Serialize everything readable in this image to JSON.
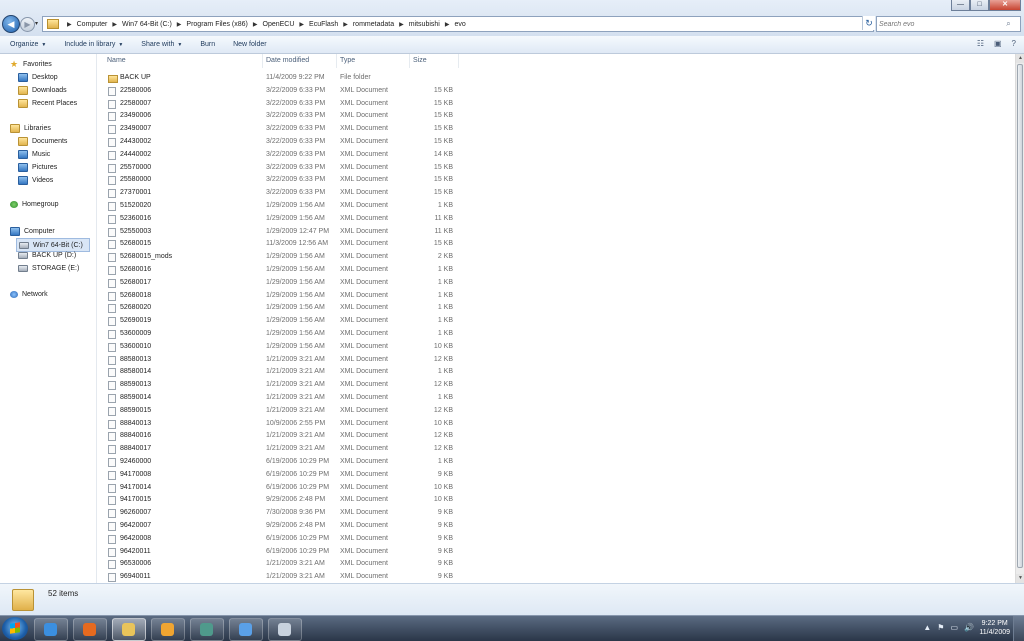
{
  "window": {
    "controls": {
      "minimize": "—",
      "maximize": "□",
      "close": "✕"
    }
  },
  "nav": {
    "back_icon": "back-arrow-icon",
    "forward_icon": "forward-arrow-icon",
    "back_glyph": "◀",
    "forward_glyph": "▶",
    "history_glyph": "▾"
  },
  "address": {
    "crumbs": [
      "Computer",
      "Win7 64-Bit (C:)",
      "Program Files (x86)",
      "OpenECU",
      "EcuFlash",
      "rommetadata",
      "mitsubishi",
      "evo"
    ],
    "separator": "▶",
    "dropdown_glyph": "▾",
    "refresh_glyph": "↻"
  },
  "search": {
    "placeholder": "Search evo",
    "icon_glyph": "⌕"
  },
  "toolbar": {
    "organize": "Organize",
    "include": "Include in library",
    "share": "Share with",
    "burn": "Burn",
    "new_folder": "New folder",
    "dropdown_glyph": "▼",
    "view_glyph": "☷",
    "pane_glyph": "▣",
    "help_glyph": "?"
  },
  "sidebar": {
    "favorites": {
      "label": "Favorites",
      "items": [
        "Desktop",
        "Downloads",
        "Recent Places"
      ]
    },
    "libraries": {
      "label": "Libraries",
      "items": [
        "Documents",
        "Music",
        "Pictures",
        "Videos"
      ]
    },
    "homegroup": "Homegroup",
    "computer": {
      "label": "Computer",
      "items": [
        "Win7 64-Bit (C:)",
        "BACK UP (D:)",
        "STORAGE (E:)"
      ]
    },
    "network": "Network"
  },
  "columns": {
    "name": "Name",
    "date": "Date modified",
    "type": "Type",
    "size": "Size"
  },
  "files": [
    {
      "name": "BACK UP",
      "date": "11/4/2009 9:22 PM",
      "type": "File folder",
      "size": "",
      "folder": true
    },
    {
      "name": "22580006",
      "date": "3/22/2009 6:33 PM",
      "type": "XML Document",
      "size": "15 KB"
    },
    {
      "name": "22580007",
      "date": "3/22/2009 6:33 PM",
      "type": "XML Document",
      "size": "15 KB"
    },
    {
      "name": "23490006",
      "date": "3/22/2009 6:33 PM",
      "type": "XML Document",
      "size": "15 KB"
    },
    {
      "name": "23490007",
      "date": "3/22/2009 6:33 PM",
      "type": "XML Document",
      "size": "15 KB"
    },
    {
      "name": "24430002",
      "date": "3/22/2009 6:33 PM",
      "type": "XML Document",
      "size": "15 KB"
    },
    {
      "name": "24440002",
      "date": "3/22/2009 6:33 PM",
      "type": "XML Document",
      "size": "14 KB"
    },
    {
      "name": "25570000",
      "date": "3/22/2009 6:33 PM",
      "type": "XML Document",
      "size": "15 KB"
    },
    {
      "name": "25580000",
      "date": "3/22/2009 6:33 PM",
      "type": "XML Document",
      "size": "15 KB"
    },
    {
      "name": "27370001",
      "date": "3/22/2009 6:33 PM",
      "type": "XML Document",
      "size": "15 KB"
    },
    {
      "name": "51520020",
      "date": "1/29/2009 1:56 AM",
      "type": "XML Document",
      "size": "1 KB"
    },
    {
      "name": "52360016",
      "date": "1/29/2009 1:56 AM",
      "type": "XML Document",
      "size": "11 KB"
    },
    {
      "name": "52550003",
      "date": "1/29/2009 12:47 PM",
      "type": "XML Document",
      "size": "11 KB"
    },
    {
      "name": "52680015",
      "date": "11/3/2009 12:56 AM",
      "type": "XML Document",
      "size": "15 KB"
    },
    {
      "name": "52680015_mods",
      "date": "1/29/2009 1:56 AM",
      "type": "XML Document",
      "size": "2 KB"
    },
    {
      "name": "52680016",
      "date": "1/29/2009 1:56 AM",
      "type": "XML Document",
      "size": "1 KB"
    },
    {
      "name": "52680017",
      "date": "1/29/2009 1:56 AM",
      "type": "XML Document",
      "size": "1 KB"
    },
    {
      "name": "52680018",
      "date": "1/29/2009 1:56 AM",
      "type": "XML Document",
      "size": "1 KB"
    },
    {
      "name": "52680020",
      "date": "1/29/2009 1:56 AM",
      "type": "XML Document",
      "size": "1 KB"
    },
    {
      "name": "52690019",
      "date": "1/29/2009 1:56 AM",
      "type": "XML Document",
      "size": "1 KB"
    },
    {
      "name": "53600009",
      "date": "1/29/2009 1:56 AM",
      "type": "XML Document",
      "size": "1 KB"
    },
    {
      "name": "53600010",
      "date": "1/29/2009 1:56 AM",
      "type": "XML Document",
      "size": "10 KB"
    },
    {
      "name": "88580013",
      "date": "1/21/2009 3:21 AM",
      "type": "XML Document",
      "size": "12 KB"
    },
    {
      "name": "88580014",
      "date": "1/21/2009 3:21 AM",
      "type": "XML Document",
      "size": "1 KB"
    },
    {
      "name": "88590013",
      "date": "1/21/2009 3:21 AM",
      "type": "XML Document",
      "size": "12 KB"
    },
    {
      "name": "88590014",
      "date": "1/21/2009 3:21 AM",
      "type": "XML Document",
      "size": "1 KB"
    },
    {
      "name": "88590015",
      "date": "1/21/2009 3:21 AM",
      "type": "XML Document",
      "size": "12 KB"
    },
    {
      "name": "88840013",
      "date": "10/9/2006 2:55 PM",
      "type": "XML Document",
      "size": "10 KB"
    },
    {
      "name": "88840016",
      "date": "1/21/2009 3:21 AM",
      "type": "XML Document",
      "size": "12 KB"
    },
    {
      "name": "88840017",
      "date": "1/21/2009 3:21 AM",
      "type": "XML Document",
      "size": "12 KB"
    },
    {
      "name": "92460000",
      "date": "6/19/2006 10:29 PM",
      "type": "XML Document",
      "size": "1 KB"
    },
    {
      "name": "94170008",
      "date": "6/19/2006 10:29 PM",
      "type": "XML Document",
      "size": "9 KB"
    },
    {
      "name": "94170014",
      "date": "6/19/2006 10:29 PM",
      "type": "XML Document",
      "size": "10 KB"
    },
    {
      "name": "94170015",
      "date": "9/29/2006 2:48 PM",
      "type": "XML Document",
      "size": "10 KB"
    },
    {
      "name": "96260007",
      "date": "7/30/2008 9:36 PM",
      "type": "XML Document",
      "size": "9 KB"
    },
    {
      "name": "96420007",
      "date": "9/29/2006 2:48 PM",
      "type": "XML Document",
      "size": "9 KB"
    },
    {
      "name": "96420008",
      "date": "6/19/2006 10:29 PM",
      "type": "XML Document",
      "size": "9 KB"
    },
    {
      "name": "96420011",
      "date": "6/19/2006 10:29 PM",
      "type": "XML Document",
      "size": "9 KB"
    },
    {
      "name": "96530006",
      "date": "1/21/2009 3:21 AM",
      "type": "XML Document",
      "size": "9 KB"
    },
    {
      "name": "96940011",
      "date": "1/21/2009 3:21 AM",
      "type": "XML Document",
      "size": "9 KB"
    }
  ],
  "status": {
    "count": "52 items"
  },
  "taskbar": {
    "apps": [
      {
        "name": "ie-icon",
        "color": "#3b8fe0"
      },
      {
        "name": "firefox-icon",
        "color": "#e66a1f"
      },
      {
        "name": "explorer-icon",
        "color": "#e9c45a"
      },
      {
        "name": "media-player-icon",
        "color": "#f0a531"
      },
      {
        "name": "ecuflash-icon",
        "color": "#4f9a8c"
      },
      {
        "name": "itunes-icon",
        "color": "#5aa0e8"
      },
      {
        "name": "paint-icon",
        "color": "#c8d2de"
      }
    ],
    "tray_glyphs": [
      "▲",
      "⚑",
      "▭",
      "🔊"
    ],
    "time": "9:22 PM",
    "date": "11/4/2009"
  }
}
